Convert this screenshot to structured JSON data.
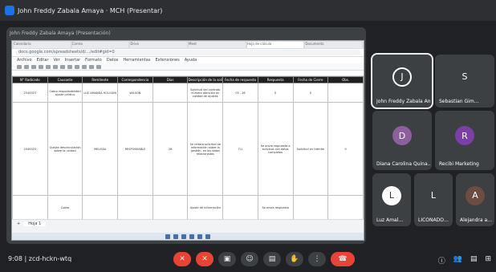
{
  "window": {
    "title": "John Freddy Zabala Amaya · MCH (Presentar)"
  },
  "presenting": {
    "banner": "John Freddy Zabala Amaya (Presentación)"
  },
  "browser": {
    "tabs": [
      "Calendario",
      "Correo",
      "Drive",
      "Meet",
      "Hoja de cálculo",
      "Documento"
    ],
    "url": "docs.google.com/spreadsheets/d/…/edit#gid=0"
  },
  "sheets": {
    "menu": [
      "Archivo",
      "Editar",
      "Ver",
      "Insertar",
      "Formato",
      "Datos",
      "Herramientas",
      "Extensiones",
      "Ayuda"
    ],
    "headers": [
      "N° Radicado",
      "Causante",
      "Remitente",
      "Correspondencia",
      "Días",
      "Descripción de la solicitud",
      "Fecha de respuesta",
      "Respuesta",
      "Fecha de Cierre",
      "Obs."
    ],
    "rows": [
      [
        "2540023",
        "Cobro responsabilidad ajuste jurídico",
        "LUZ AMANDA HOLGUIN",
        "WILSON",
        "",
        "Solicitud del contrato número atención en calidad de ajustes",
        "05 - 26",
        "0",
        "0",
        ""
      ],
      [
        "2540025",
        "Quejas desvinculación sobre la unidad",
        "MELISSA",
        "RESPONSABLE",
        "28",
        "Se reitera solicitud de información sobre la gestión, en los datos relacionados",
        "7/1",
        "Se envía respuesta a solicitud con datos completos",
        "Solicitud en trámite",
        "0"
      ],
      [
        "",
        "Cobro",
        "",
        "",
        "",
        "Ajuste de información",
        "",
        "Se envía respuesta",
        "",
        ""
      ]
    ],
    "sheet_tab": "Hoja 1"
  },
  "participants": [
    {
      "name": "John Freddy Zabala Ama…",
      "initial": "J",
      "color": "#3c4043"
    },
    {
      "name": "Sebastian Gim…",
      "initial": "S",
      "color": "#5f6368"
    },
    {
      "name": "Diana Carolina Quina…",
      "initial": "D",
      "color": "#8e5f9e"
    },
    {
      "name": "Recibi Marketing",
      "initial": "R",
      "color": "#7b3fa8"
    },
    {
      "name": "Luz Amal…",
      "initial": "L",
      "color": "#ffffff"
    },
    {
      "name": "LICONADO…",
      "initial": "L",
      "color": "#5f6368"
    },
    {
      "name": "Alejandra a…",
      "initial": "A",
      "color": "#6d4c41"
    }
  ],
  "meeting": {
    "time": "9:08",
    "code": "zcd-hckn-wtq"
  }
}
